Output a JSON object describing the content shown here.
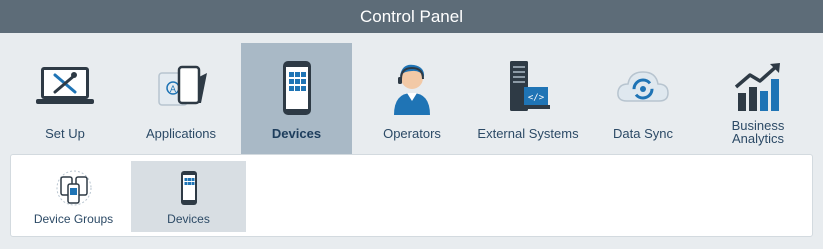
{
  "window": {
    "title": "Control Panel"
  },
  "nav": {
    "items": [
      {
        "label": "Set Up",
        "icon": "wrench-screwdriver-laptop-icon"
      },
      {
        "label": "Applications",
        "icon": "apps-tablet-icon"
      },
      {
        "label": "Devices",
        "icon": "smartphone-icon",
        "active": true
      },
      {
        "label": "Operators",
        "icon": "operator-headset-icon"
      },
      {
        "label": "External Systems",
        "icon": "server-code-icon"
      },
      {
        "label": "Data Sync",
        "icon": "cloud-sync-icon"
      },
      {
        "label": "Business Analytics",
        "icon": "bar-chart-trend-icon"
      }
    ]
  },
  "subnav": {
    "items": [
      {
        "label": "Device Groups",
        "icon": "device-group-icon"
      },
      {
        "label": "Devices",
        "icon": "smartphone-icon",
        "active": true
      }
    ]
  },
  "colors": {
    "title_bar": "#5d6c78",
    "active_tab": "#a9b9c6",
    "active_sub": "#d8dee3",
    "label_text": "#2c4a66",
    "icon_dark": "#2e3a45",
    "icon_blue": "#1f74b5"
  }
}
